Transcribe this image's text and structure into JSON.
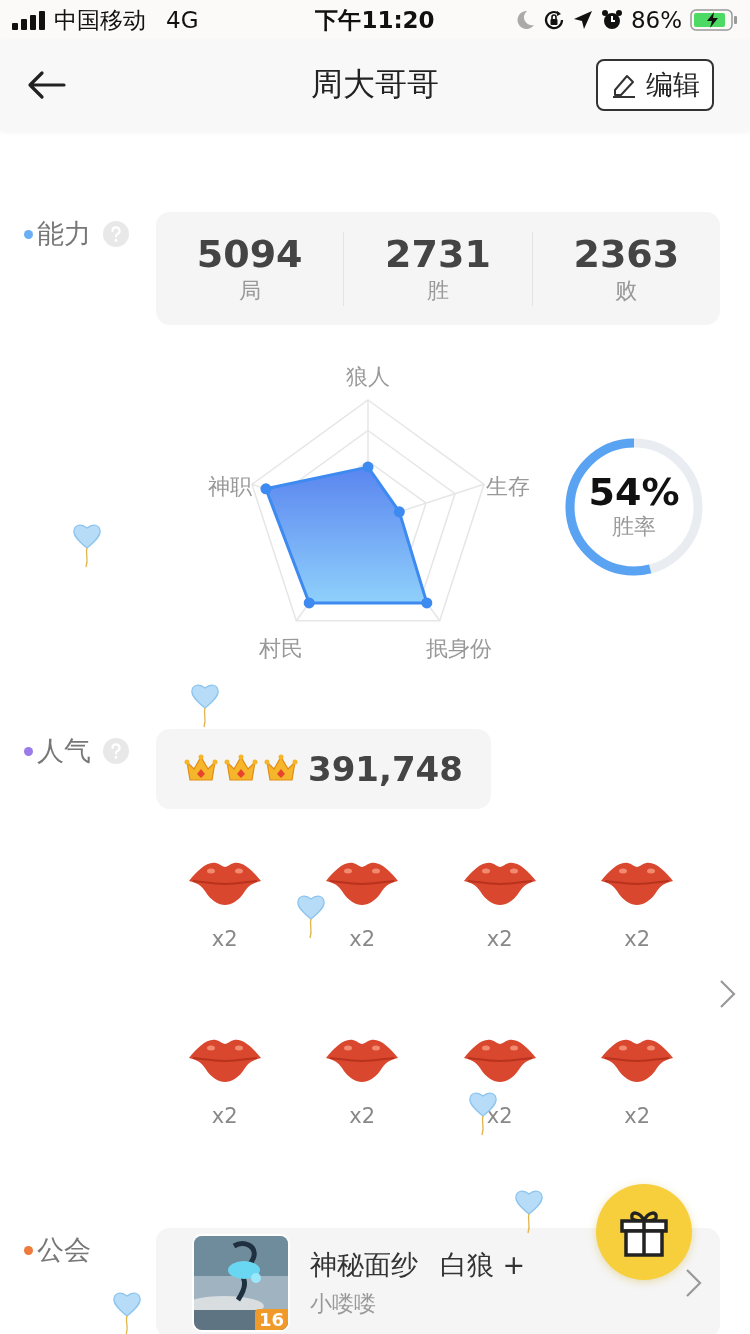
{
  "status_bar": {
    "carrier": "中国移动",
    "network": "4G",
    "time": "下午11:20",
    "battery": "86%"
  },
  "header": {
    "title": "周大哥哥",
    "edit_button": "编辑"
  },
  "ability": {
    "label": "能力",
    "color": "#6aaef5",
    "stats": [
      {
        "value": "5094",
        "label": "局"
      },
      {
        "value": "2731",
        "label": "胜"
      },
      {
        "value": "2363",
        "label": "败"
      }
    ],
    "radar_labels": [
      "狼人",
      "生存",
      "抿身份",
      "村民",
      "神职"
    ],
    "win_rate": {
      "value": "54%",
      "label": "胜率",
      "level": 0.54
    }
  },
  "popularity": {
    "label": "人气",
    "color": "#9b7bea",
    "stars": 3,
    "score": "391,748",
    "gifts": [
      {
        "count": "x2"
      },
      {
        "count": "x2"
      },
      {
        "count": "x2"
      },
      {
        "count": "x2"
      },
      {
        "count": "x2"
      },
      {
        "count": "x2"
      },
      {
        "count": "x2"
      },
      {
        "count": "x2"
      }
    ]
  },
  "guild": {
    "label": "公会",
    "color": "#ee7a3c",
    "name": "神秘面纱",
    "title": "白狼 +",
    "level": "16",
    "role": "小喽喽"
  }
}
